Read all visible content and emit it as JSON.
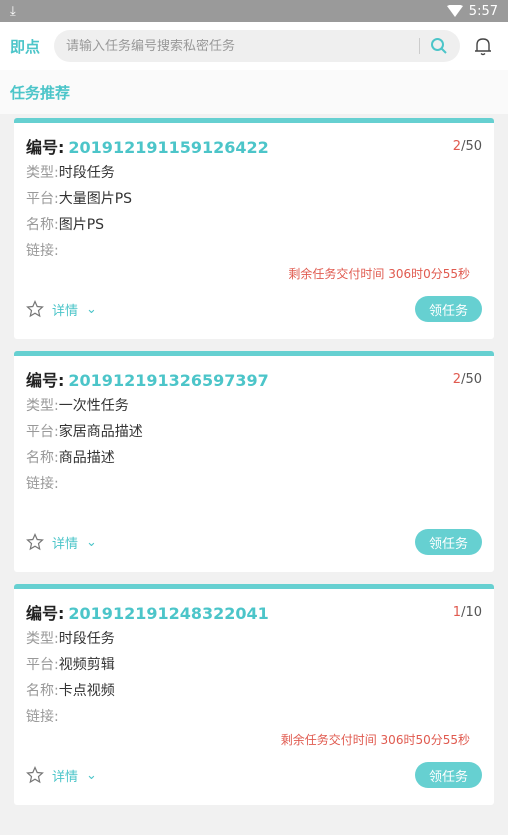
{
  "statusbar": {
    "time": "5:57"
  },
  "header": {
    "logo": "即点",
    "search_placeholder": "请输入任务编号搜索私密任务"
  },
  "section": {
    "title": "任务推荐"
  },
  "labels": {
    "num": "编号:",
    "type": "类型:",
    "platform": "平台:",
    "name": "名称:",
    "link": "链接:",
    "detail": "详情",
    "claim": "领任务"
  },
  "tasks": [
    {
      "id": "201912191159126422",
      "cur": "2",
      "total": "/50",
      "type": "时段任务",
      "platform": "大量图片PS",
      "name": "图片PS",
      "link": "",
      "remain": "剩余任务交付时间 306时0分55秒"
    },
    {
      "id": "201912191326597397",
      "cur": "2",
      "total": "/50",
      "type": "一次性任务",
      "platform": "家居商品描述",
      "name": "商品描述",
      "link": "",
      "remain": ""
    },
    {
      "id": "201912191248322041",
      "cur": "1",
      "total": "/10",
      "type": "时段任务",
      "platform": "视频剪辑",
      "name": "卡点视频",
      "link": "",
      "remain": "剩余任务交付时间 306时50分55秒"
    }
  ]
}
